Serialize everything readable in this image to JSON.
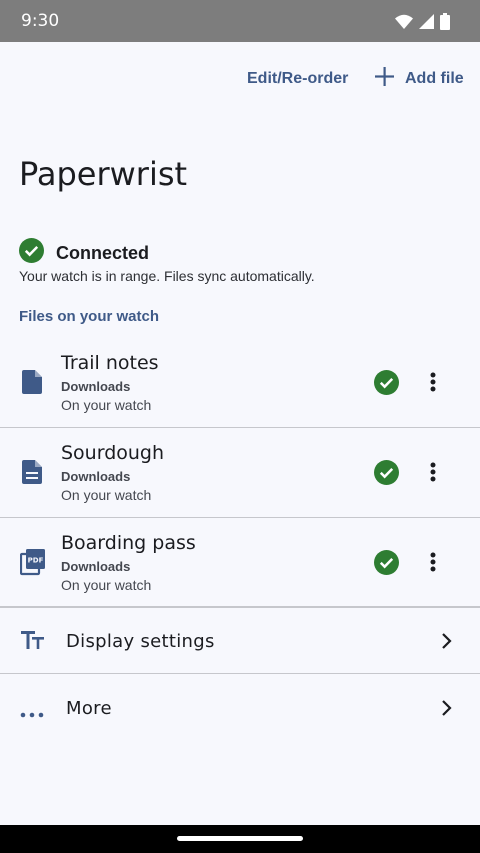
{
  "status_bar": {
    "time": "9:30",
    "icons": [
      "wifi-icon",
      "signal-icon",
      "battery-icon"
    ]
  },
  "toolbar": {
    "edit_label": "Edit/Re-order",
    "add_label": "Add file"
  },
  "app": {
    "title": "Paperwrist"
  },
  "connection": {
    "label": "Connected",
    "description": "Your watch is in range. Files sync automatically.",
    "color": "#2e7d32"
  },
  "files": {
    "section_label": "Files on your watch",
    "items": [
      {
        "name": "Trail notes",
        "folder": "Downloads",
        "status": "On your watch",
        "icon": "file-icon"
      },
      {
        "name": "Sourdough",
        "folder": "Downloads",
        "status": "On your watch",
        "icon": "document-icon"
      },
      {
        "name": "Boarding pass",
        "folder": "Downloads",
        "status": "On your watch",
        "icon": "pdf-icon"
      }
    ]
  },
  "settings": {
    "display_label": "Display settings",
    "more_label": "More"
  },
  "colors": {
    "accent": "#3f5a88",
    "success": "#2e7d32",
    "background": "#f7f8fd"
  }
}
